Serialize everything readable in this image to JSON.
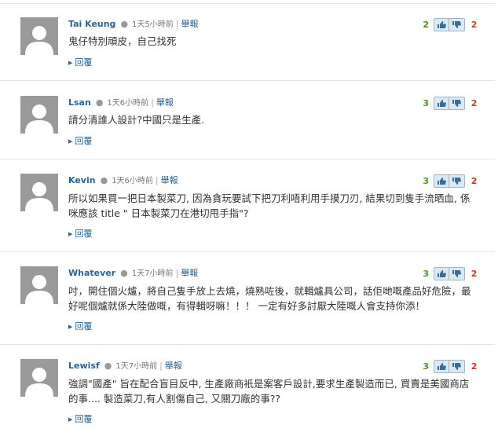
{
  "comments": [
    {
      "author": "Tai Keung",
      "time": "1天5小時前",
      "separator": "|",
      "report": "舉報",
      "text": "鬼仔特別頑皮，自己找死",
      "reply": "回覆",
      "up": "2",
      "down": "2"
    },
    {
      "author": "Lsan",
      "time": "1天6小時前",
      "separator": "|",
      "report": "舉報",
      "text": "請分清誰人設計?中國只是生產.",
      "reply": "回覆",
      "up": "3",
      "down": "2"
    },
    {
      "author": "Kevin",
      "time": "1天6小時前",
      "separator": "|",
      "report": "舉報",
      "text": "所以如果買一把日本製菜刀, 因為貪玩要試下把刀利唔利用手摸刀刃, 結果切到隻手流晒血, 係咪應該 title \" 日本製菜刀在港切甩手指\"?",
      "reply": "回覆",
      "up": "3",
      "down": "2"
    },
    {
      "author": "Whatever",
      "time": "1天7小時前",
      "separator": "|",
      "report": "舉報",
      "text": "吋，開住個火爐，將自己隻手放上去燒，燒熟咗後，就輯爐具公司，話佢哋嘅產品好危險，最好呢個爐就係大陸做嘅，有得輯呀嘛！！！ 一定有好多討厭大陸嘅人會支持你添！",
      "reply": "回覆",
      "up": "3",
      "down": "2"
    },
    {
      "author": "Lewisf",
      "time": "1天7小時前",
      "separator": "|",
      "report": "舉報",
      "text": "強調\"國產\" 旨在配合盲目反中, 生產廠商衹是案客戶設計,要求生產製造而已, 買賣是美國商店的事.... 製造菜刀,有人割傷自己, 又關刀廠的事??",
      "reply": "回覆",
      "up": "3",
      "down": "2"
    }
  ],
  "icons": {
    "avatar": "default-user-avatar",
    "vote_up": "thumbs-up-icon",
    "vote_down": "thumbs-down-icon",
    "reply_arrow": "triangle-right-icon"
  },
  "colors": {
    "link": "#2a6496",
    "up_count": "#4a9a1a",
    "down_count": "#cc3a1a",
    "avatar_bg": "#9a9a9a",
    "separator": "#e4e4e4"
  }
}
